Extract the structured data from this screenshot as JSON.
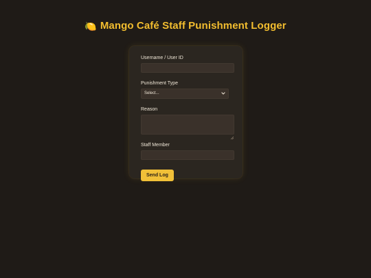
{
  "header": {
    "title_icon": "mango-icon",
    "title": "Mango Café Staff Punishment Logger"
  },
  "form": {
    "username": {
      "label": "Username / User ID",
      "value": "",
      "placeholder": ""
    },
    "punishment_type": {
      "label": "Punishment Type",
      "selected": "Select...",
      "options": [
        "Select..."
      ]
    },
    "reason": {
      "label": "Reason",
      "value": ""
    },
    "staff_member": {
      "label": "Staff Member",
      "value": ""
    },
    "submit_label": "Send Log"
  },
  "colors": {
    "background": "#1f1b17",
    "card": "#2b2620",
    "input": "#3a312a",
    "accent": "#f2bd2f"
  }
}
